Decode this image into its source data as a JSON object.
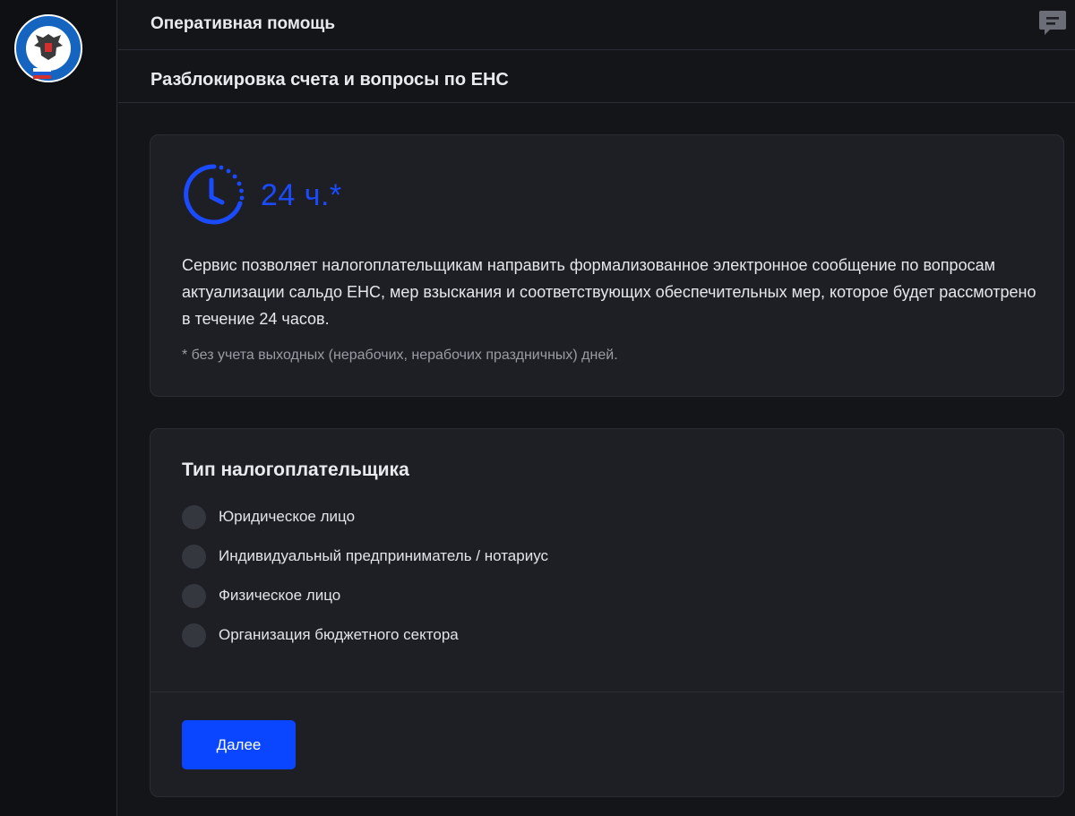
{
  "header": {
    "title": "Оперативная помощь",
    "chat_icon": "chat-message-icon"
  },
  "logo": {
    "icon": "fns-emblem-logo",
    "text": "ФЕДЕРАЛЬНАЯ НАЛОГОВАЯ СЛУЖБА"
  },
  "subheader": {
    "title": "Разблокировка счета и вопросы по ЕНС"
  },
  "info": {
    "clock_icon": "clock-icon",
    "hours": "24 ч.*",
    "description": "Сервис позволяет налогоплательщикам направить формализованное электронное сообщение по вопросам актуализации сальдо ЕНС, мер взыскания и соответствующих обеспечительных мер, которое будет рассмотрено в течение 24 часов.",
    "note": "* без учета выходных (нерабочих, нерабочих праздничных) дней."
  },
  "form": {
    "title": "Тип налогоплательщика",
    "options": [
      {
        "label": "Юридическое лицо",
        "selected": false
      },
      {
        "label": "Индивидуальный предприниматель / нотариус",
        "selected": false
      },
      {
        "label": "Физическое лицо",
        "selected": false
      },
      {
        "label": "Организация бюджетного сектора",
        "selected": false
      }
    ],
    "next_label": "Далее"
  },
  "colors": {
    "accent": "#0a46ff",
    "accent_text": "#1a4bff",
    "background": "#141519",
    "card": "#1e1f24"
  }
}
